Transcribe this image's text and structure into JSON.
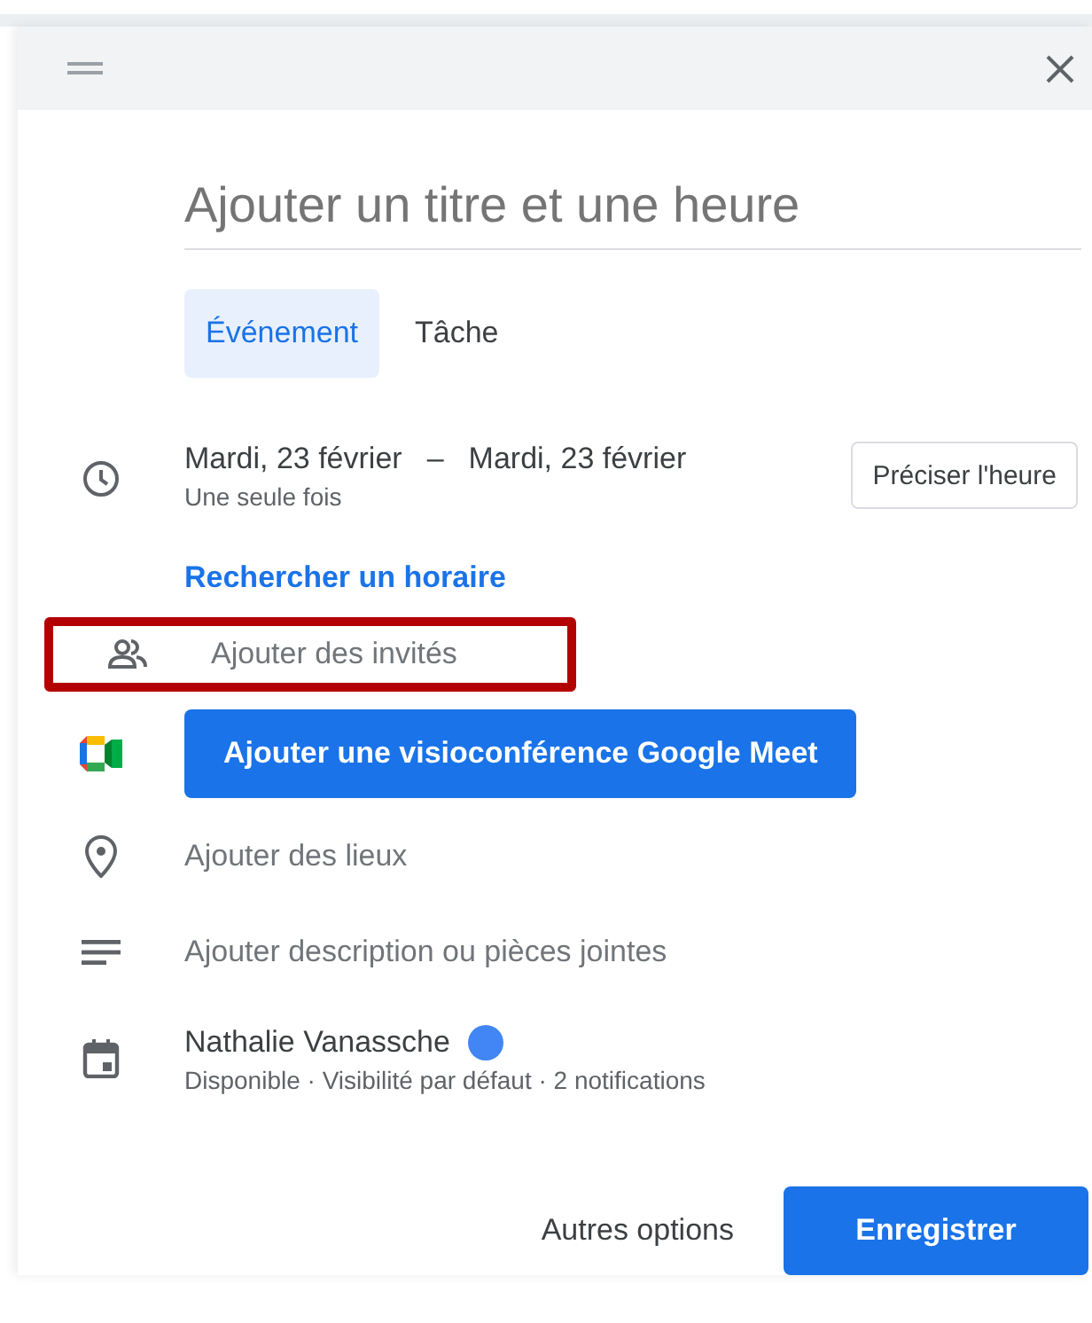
{
  "title_field": {
    "placeholder": "Ajouter un titre et une heure"
  },
  "tabs": [
    {
      "label": "Événement",
      "selected": true
    },
    {
      "label": "Tâche",
      "selected": false
    }
  ],
  "date": {
    "start": "Mardi, 23 février",
    "separator": "–",
    "end": "Mardi, 23 février",
    "recurrence": "Une seule fois",
    "time_button": "Préciser l'heure"
  },
  "schedule_link": "Rechercher un horaire",
  "guests": {
    "placeholder": "Ajouter des invités",
    "highlighted": true
  },
  "meet_button": "Ajouter une visioconférence Google Meet",
  "location": {
    "placeholder": "Ajouter des lieux"
  },
  "description": {
    "placeholder": "Ajouter description ou pièces jointes"
  },
  "calendar": {
    "owner": "Nathalie Vanassche",
    "color": "#4285f4",
    "details": "Disponible · Visibilité par défaut · 2 notifications"
  },
  "footer": {
    "more_options": "Autres options",
    "save": "Enregistrer"
  }
}
